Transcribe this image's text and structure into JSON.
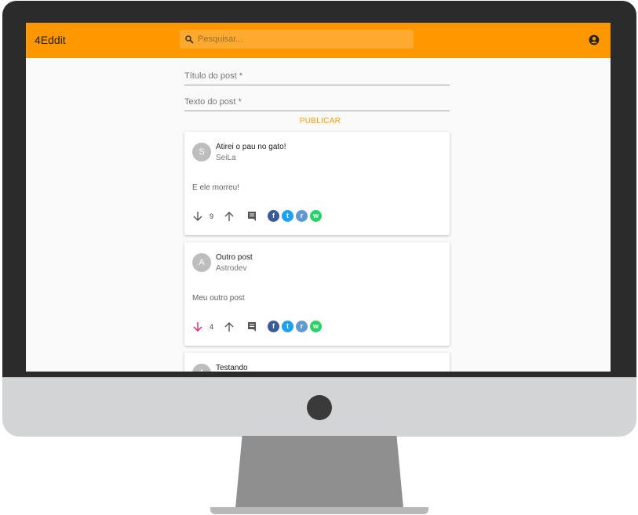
{
  "app": {
    "brand": "4Eddit"
  },
  "search": {
    "placeholder": "Pesquisar..."
  },
  "form": {
    "title_label": "Título do post *",
    "text_label": "Texto do post *",
    "publish_label": "PUBLICAR"
  },
  "posts": [
    {
      "avatar": "S",
      "title": "Atirei o pau no gato!",
      "author": "SeiLa",
      "text": "E ele morreu!",
      "votes": "9",
      "vote_state": "none"
    },
    {
      "avatar": "A",
      "title": "Outro post",
      "author": "Astrodev",
      "text": "Meu outro post",
      "votes": "4",
      "vote_state": "down"
    },
    {
      "avatar": "A",
      "title": "Testando"
    }
  ],
  "colors": {
    "appbar": "#ff9800",
    "publish": "#ff9800",
    "downvote_active": "#e91e63",
    "facebook": "#3b5998",
    "twitter": "#1da1f2",
    "reddit": "#5f99cf",
    "whatsapp": "#25d366"
  },
  "icons": {
    "search": "search-icon",
    "account": "account-circle-icon",
    "downvote": "arrow-down-icon",
    "upvote": "arrow-up-icon",
    "comment": "comment-icon",
    "share": [
      "facebook-icon",
      "twitter-icon",
      "reddit-icon",
      "whatsapp-icon"
    ]
  }
}
